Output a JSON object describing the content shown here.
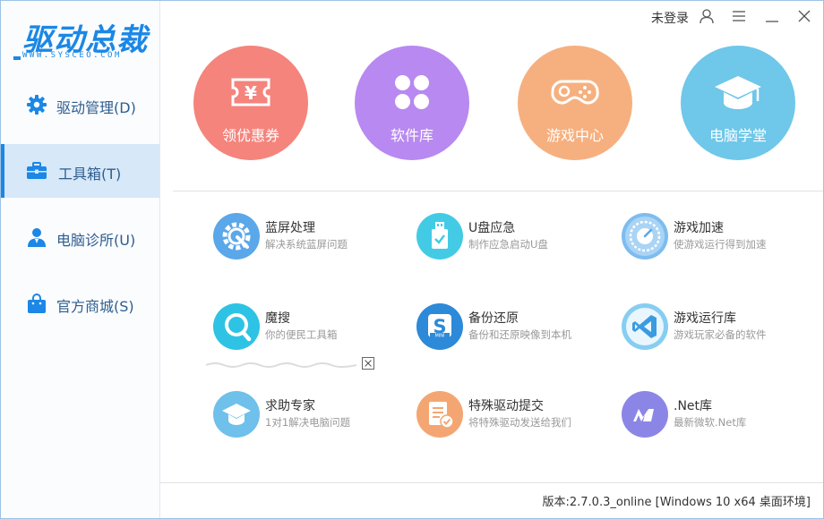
{
  "app": {
    "logo_text": "驱动总裁",
    "logo_sub": "WWW.SYSCEO.COM",
    "brand_color": "#1b87e6"
  },
  "titlebar": {
    "login_label": "未登录",
    "icons": [
      "user-icon",
      "menu-icon",
      "minimize-icon",
      "close-icon"
    ]
  },
  "sidebar": {
    "items": [
      {
        "label": "驱动管理(D)",
        "icon": "gear-icon",
        "active": false
      },
      {
        "label": "工具箱(T)",
        "icon": "toolbox-icon",
        "active": true
      },
      {
        "label": "电脑诊所(U)",
        "icon": "doctor-icon",
        "active": false
      },
      {
        "label": "官方商城(S)",
        "icon": "shopping-bag-icon",
        "active": false
      }
    ]
  },
  "features": [
    {
      "label": "领优惠券",
      "icon": "coupon-icon",
      "color": "#f4847c"
    },
    {
      "label": "软件库",
      "icon": "clover-icon",
      "color": "#b889f0"
    },
    {
      "label": "游戏中心",
      "icon": "gamepad-icon",
      "color": "#f6b07f"
    },
    {
      "label": "电脑学堂",
      "icon": "graduation-cap-icon",
      "color": "#6fc7e9"
    }
  ],
  "tools": [
    {
      "name": "蓝屏处理",
      "desc": "解决系统蓝屏问题",
      "icon": "gear-wrench-icon",
      "color": "#5aa7ea"
    },
    {
      "name": "U盘应急",
      "desc": "制作应急启动U盘",
      "icon": "usb-drive-icon",
      "color": "#43cbe6"
    },
    {
      "name": "游戏加速",
      "desc": "使游戏运行得到加速",
      "icon": "speedometer-icon",
      "color": "#7dbcef"
    },
    {
      "name": "魔搜",
      "desc": "你的便民工具箱",
      "icon": "magnifier-icon",
      "color": "#2ec3e4"
    },
    {
      "name": "备份还原",
      "desc": "备份和还原映像到本机",
      "icon": "backup-icon",
      "color": "#2c8ad8"
    },
    {
      "name": "游戏运行库",
      "desc": "游戏玩家必备的软件",
      "icon": "visual-studio-icon",
      "color": "#86cef1"
    },
    {
      "name": "求助专家",
      "desc": "1对1解决电脑问题",
      "icon": "expert-cap-icon",
      "color": "#6fc0ea"
    },
    {
      "name": "特殊驱动提交",
      "desc": "将特殊驱动发送给我们",
      "icon": "document-check-icon",
      "color": "#f4a672"
    },
    {
      "name": ".Net库",
      "desc": "最新微软.Net库",
      "icon": "dotnet-icon",
      "color": "#8b86e6"
    }
  ],
  "statusbar": {
    "version": "版本:2.7.0.3_online [Windows 10 x64 桌面环境]"
  }
}
